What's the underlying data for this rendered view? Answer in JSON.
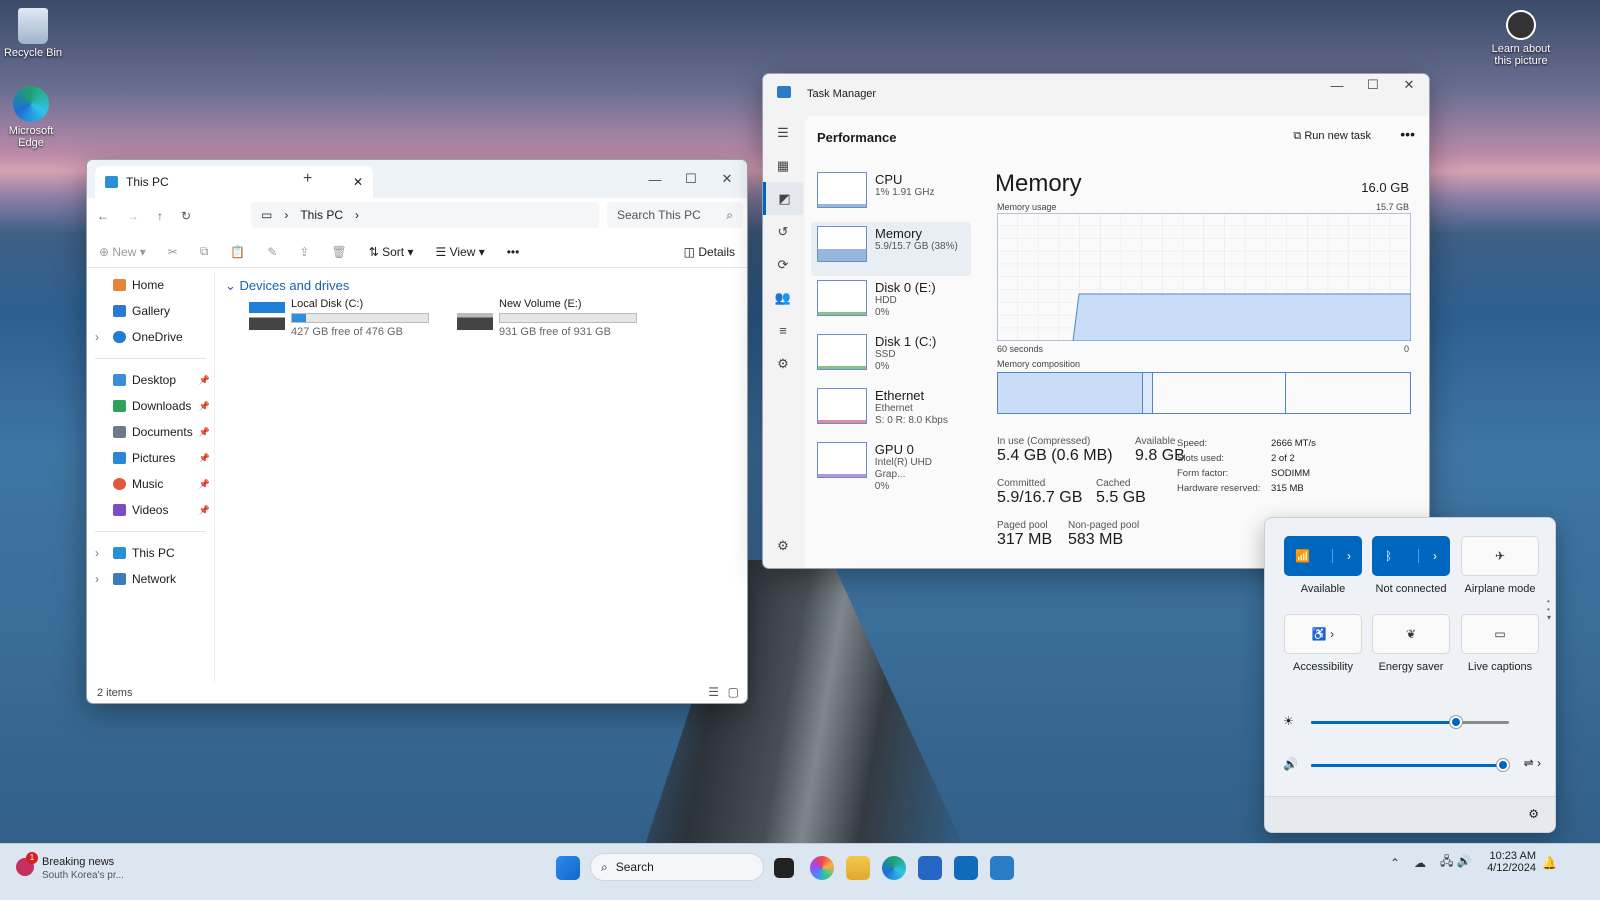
{
  "desktop": {
    "icons": [
      "Recycle Bin",
      "Microsoft Edge",
      "Learn about this picture"
    ]
  },
  "explorer": {
    "tab_title": "This PC",
    "breadcrumb": "This PC",
    "search_placeholder": "Search This PC",
    "toolbar": {
      "new": "New",
      "sort": "Sort",
      "view": "View",
      "details": "Details"
    },
    "sidebar": {
      "home": "Home",
      "gallery": "Gallery",
      "onedrive": "OneDrive",
      "desktop": "Desktop",
      "downloads": "Downloads",
      "documents": "Documents",
      "pictures": "Pictures",
      "music": "Music",
      "videos": "Videos",
      "thispc": "This PC",
      "network": "Network"
    },
    "group_header": "Devices and drives",
    "drives": [
      {
        "name": "Local Disk (C:)",
        "free": "427 GB free of 476 GB",
        "used_fraction": 0.1
      },
      {
        "name": "New Volume (E:)",
        "free": "931 GB free of 931 GB",
        "used_fraction": 0.0
      }
    ],
    "status": "2 items"
  },
  "taskmgr": {
    "title": "Task Manager",
    "section": "Performance",
    "run_new_task": "Run new task",
    "list": [
      {
        "name": "CPU",
        "l2": "1% 1.91 GHz",
        "l3": ""
      },
      {
        "name": "Memory",
        "l2": "5.9/15.7 GB (38%)",
        "l3": ""
      },
      {
        "name": "Disk 0 (E:)",
        "l2": "HDD",
        "l3": "0%"
      },
      {
        "name": "Disk 1 (C:)",
        "l2": "SSD",
        "l3": "0%"
      },
      {
        "name": "Ethernet",
        "l2": "Ethernet",
        "l3": "S: 0 R: 8.0 Kbps"
      },
      {
        "name": "GPU 0",
        "l2": "Intel(R) UHD Grap...",
        "l3": "0%"
      }
    ],
    "memory": {
      "title": "Memory",
      "total": "16.0 GB",
      "usage_label": "Memory usage",
      "usage_max": "15.7 GB",
      "axis_left": "60 seconds",
      "axis_right": "0",
      "composition_label": "Memory composition",
      "stats": {
        "in_use_label": "In use (Compressed)",
        "in_use": "5.4 GB (0.6 MB)",
        "available_label": "Available",
        "available": "9.8 GB",
        "committed_label": "Committed",
        "committed": "5.9/16.7 GB",
        "cached_label": "Cached",
        "cached": "5.5 GB",
        "paged_label": "Paged pool",
        "paged": "317 MB",
        "nonpaged_label": "Non-paged pool",
        "nonpaged": "583 MB"
      },
      "specs": {
        "speed_label": "Speed:",
        "speed": "2666 MT/s",
        "slots_label": "Slots used:",
        "slots": "2 of 2",
        "form_label": "Form factor:",
        "form": "SODIMM",
        "hw_label": "Hardware reserved:",
        "hw": "315 MB"
      }
    }
  },
  "quick_settings": {
    "tiles": [
      "Available",
      "Not connected",
      "Airplane mode",
      "Accessibility",
      "Energy saver",
      "Live captions"
    ],
    "brightness": 0.73,
    "volume": 0.97
  },
  "taskbar": {
    "news_title": "Breaking news",
    "news_sub": "South Korea's pr...",
    "news_badge": "1",
    "search": "Search",
    "time": "10:23 AM",
    "date": "4/12/2024"
  },
  "colors": {
    "accent": "#0067c0",
    "memory_fill": "#c9ddf6",
    "memory_line": "#4f86c6"
  }
}
